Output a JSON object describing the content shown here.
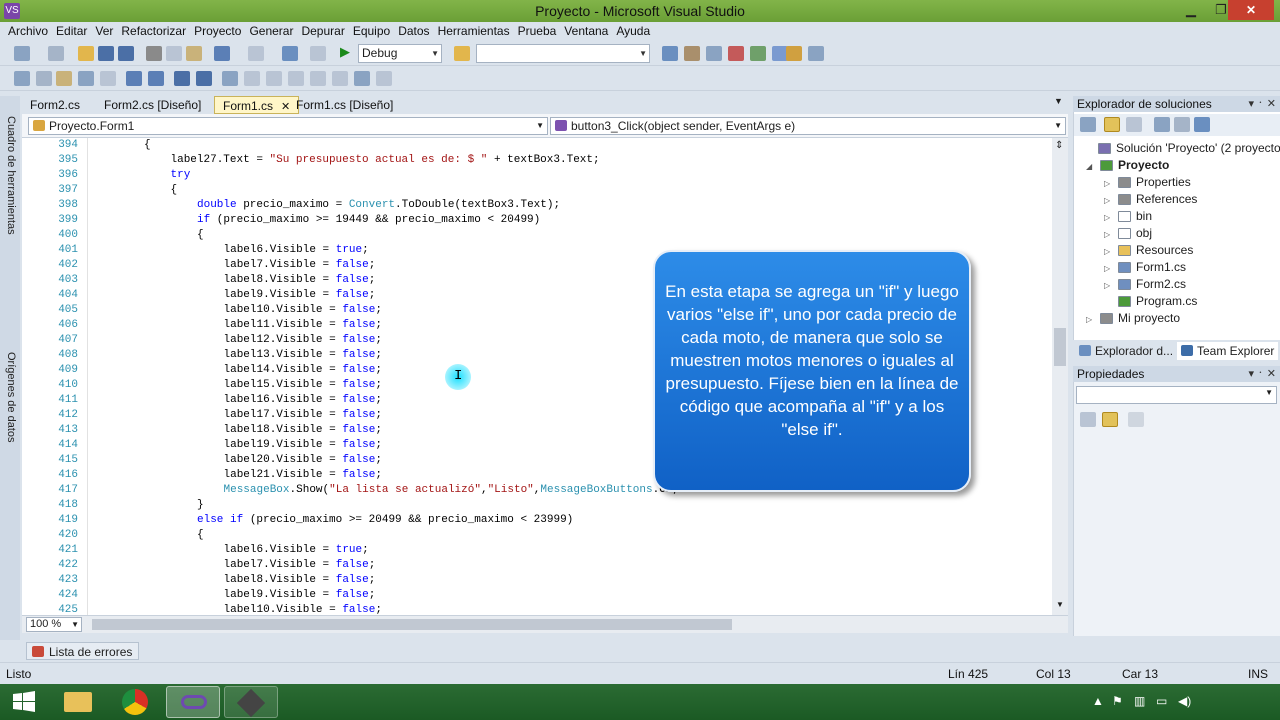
{
  "window": {
    "title": "Proyecto - Microsoft Visual Studio",
    "minimize": "▁",
    "restore": "❐",
    "close": "✕",
    "app_icon": "VS"
  },
  "menu": [
    "Archivo",
    "Editar",
    "Ver",
    "Refactorizar",
    "Proyecto",
    "Generar",
    "Depurar",
    "Equipo",
    "Datos",
    "Herramientas",
    "Prueba",
    "Ventana",
    "Ayuda"
  ],
  "toolbar": {
    "config": "Debug",
    "platform": ""
  },
  "left_tabs": {
    "toolbox": "Cuadro de herramientas",
    "datasources": "Orígenes de datos"
  },
  "editor_tabs": [
    {
      "label": "Form2.cs",
      "active": false
    },
    {
      "label": "Form2.cs [Diseño]",
      "active": false
    },
    {
      "label": "Form1.cs",
      "active": true
    },
    {
      "label": "Form1.cs [Diseño]",
      "active": false
    }
  ],
  "nav": {
    "class_combo": "Proyecto.Form1",
    "member_combo": "button3_Click(object sender, EventArgs e)"
  },
  "code": {
    "lines": [
      {
        "n": "394",
        "indent": 3,
        "parts": [
          [
            "",
            "{"
          ]
        ]
      },
      {
        "n": "395",
        "indent": 4,
        "parts": [
          [
            "",
            "label27.Text = "
          ],
          [
            "st",
            "\"Su presupuesto actual es de: $ \""
          ],
          [
            "",
            " + textBox3.Text;"
          ]
        ]
      },
      {
        "n": "396",
        "indent": 4,
        "parts": [
          [
            "kw",
            "try"
          ]
        ]
      },
      {
        "n": "397",
        "indent": 4,
        "parts": [
          [
            "",
            "{"
          ]
        ]
      },
      {
        "n": "398",
        "indent": 5,
        "parts": [
          [
            "kw",
            "double"
          ],
          [
            "",
            " precio_maximo = "
          ],
          [
            "ty",
            "Convert"
          ],
          [
            "",
            ".ToDouble(textBox3.Text);"
          ]
        ]
      },
      {
        "n": "399",
        "indent": 5,
        "parts": [
          [
            "kw",
            "if"
          ],
          [
            "",
            " (precio_maximo >= 19449 && precio_maximo < 20499)"
          ]
        ]
      },
      {
        "n": "400",
        "indent": 5,
        "parts": [
          [
            "",
            "{"
          ]
        ]
      },
      {
        "n": "401",
        "indent": 6,
        "parts": [
          [
            "",
            "label6.Visible = "
          ],
          [
            "kw",
            "true"
          ],
          [
            "",
            ";"
          ]
        ]
      },
      {
        "n": "402",
        "indent": 6,
        "parts": [
          [
            "",
            "label7.Visible = "
          ],
          [
            "kw",
            "false"
          ],
          [
            "",
            ";"
          ]
        ]
      },
      {
        "n": "403",
        "indent": 6,
        "parts": [
          [
            "",
            "label8.Visible = "
          ],
          [
            "kw",
            "false"
          ],
          [
            "",
            ";"
          ]
        ]
      },
      {
        "n": "404",
        "indent": 6,
        "parts": [
          [
            "",
            "label9.Visible = "
          ],
          [
            "kw",
            "false"
          ],
          [
            "",
            ";"
          ]
        ]
      },
      {
        "n": "405",
        "indent": 6,
        "parts": [
          [
            "",
            "label10.Visible = "
          ],
          [
            "kw",
            "false"
          ],
          [
            "",
            ";"
          ]
        ]
      },
      {
        "n": "406",
        "indent": 6,
        "parts": [
          [
            "",
            "label11.Visible = "
          ],
          [
            "kw",
            "false"
          ],
          [
            "",
            ";"
          ]
        ]
      },
      {
        "n": "407",
        "indent": 6,
        "parts": [
          [
            "",
            "label12.Visible = "
          ],
          [
            "kw",
            "false"
          ],
          [
            "",
            ";"
          ]
        ]
      },
      {
        "n": "408",
        "indent": 6,
        "parts": [
          [
            "",
            "label13.Visible = "
          ],
          [
            "kw",
            "false"
          ],
          [
            "",
            ";"
          ]
        ]
      },
      {
        "n": "409",
        "indent": 6,
        "parts": [
          [
            "",
            "label14.Visible = "
          ],
          [
            "kw",
            "false"
          ],
          [
            "",
            ";"
          ]
        ]
      },
      {
        "n": "410",
        "indent": 6,
        "parts": [
          [
            "",
            "label15.Visible = "
          ],
          [
            "kw",
            "false"
          ],
          [
            "",
            ";"
          ]
        ]
      },
      {
        "n": "411",
        "indent": 6,
        "parts": [
          [
            "",
            "label16.Visible = "
          ],
          [
            "kw",
            "false"
          ],
          [
            "",
            ";"
          ]
        ]
      },
      {
        "n": "412",
        "indent": 6,
        "parts": [
          [
            "",
            "label17.Visible = "
          ],
          [
            "kw",
            "false"
          ],
          [
            "",
            ";"
          ]
        ]
      },
      {
        "n": "413",
        "indent": 6,
        "parts": [
          [
            "",
            "label18.Visible = "
          ],
          [
            "kw",
            "false"
          ],
          [
            "",
            ";"
          ]
        ]
      },
      {
        "n": "414",
        "indent": 6,
        "parts": [
          [
            "",
            "label19.Visible = "
          ],
          [
            "kw",
            "false"
          ],
          [
            "",
            ";"
          ]
        ]
      },
      {
        "n": "415",
        "indent": 6,
        "parts": [
          [
            "",
            "label20.Visible = "
          ],
          [
            "kw",
            "false"
          ],
          [
            "",
            ";"
          ]
        ]
      },
      {
        "n": "416",
        "indent": 6,
        "parts": [
          [
            "",
            "label21.Visible = "
          ],
          [
            "kw",
            "false"
          ],
          [
            "",
            ";"
          ]
        ]
      },
      {
        "n": "417",
        "indent": 6,
        "parts": [
          [
            "ty",
            "MessageBox"
          ],
          [
            "",
            ".Show("
          ],
          [
            "st",
            "\"La lista se actualizó\""
          ],
          [
            "",
            ","
          ],
          [
            "st",
            "\"Listo\""
          ],
          [
            "",
            ","
          ],
          [
            "ty",
            "MessageBoxButtons"
          ],
          [
            "",
            ".OK,"
          ]
        ]
      },
      {
        "n": "418",
        "indent": 5,
        "parts": [
          [
            "",
            "}"
          ]
        ]
      },
      {
        "n": "419",
        "indent": 5,
        "parts": [
          [
            "kw",
            "else if"
          ],
          [
            "",
            " (precio_maximo >= 20499 && precio_maximo < 23999)"
          ]
        ]
      },
      {
        "n": "420",
        "indent": 5,
        "parts": [
          [
            "",
            "{"
          ]
        ]
      },
      {
        "n": "421",
        "indent": 6,
        "parts": [
          [
            "",
            "label6.Visible = "
          ],
          [
            "kw",
            "true"
          ],
          [
            "",
            ";"
          ]
        ]
      },
      {
        "n": "422",
        "indent": 6,
        "parts": [
          [
            "",
            "label7.Visible = "
          ],
          [
            "kw",
            "false"
          ],
          [
            "",
            ";"
          ]
        ]
      },
      {
        "n": "423",
        "indent": 6,
        "parts": [
          [
            "",
            "label8.Visible = "
          ],
          [
            "kw",
            "false"
          ],
          [
            "",
            ";"
          ]
        ]
      },
      {
        "n": "424",
        "indent": 6,
        "parts": [
          [
            "",
            "label9.Visible = "
          ],
          [
            "kw",
            "false"
          ],
          [
            "",
            ";"
          ]
        ]
      },
      {
        "n": "425",
        "indent": 6,
        "parts": [
          [
            "",
            "label10.Visible = "
          ],
          [
            "kw",
            "false"
          ],
          [
            "",
            ";"
          ]
        ]
      }
    ]
  },
  "zoom": "100 %",
  "callout": "En esta etapa se agrega un \"if\" y luego varios \"else if\", uno por cada precio de cada moto, de manera que solo se muestren motos menores o iguales al presupuesto. Fíjese bien en la línea de código que acompaña al \"if\" y a los \"else if\".",
  "error_list": "Lista de errores",
  "status": {
    "left": "Listo",
    "line": "Lín 425",
    "col": "Col 13",
    "car": "Car 13",
    "mode": "INS"
  },
  "solution_explorer": {
    "title": "Explorador de soluciones",
    "pins": "▾ ᛫ ✕",
    "items": [
      {
        "label": "Solución 'Proyecto' (2 proyectos)",
        "level": 0,
        "expander": "",
        "icon": "#7a6fb0",
        "bold": false
      },
      {
        "label": "Proyecto",
        "level": 1,
        "expander": "◢",
        "icon": "#4c9a3a",
        "bold": true
      },
      {
        "label": "Properties",
        "level": 2,
        "expander": "▷",
        "icon": "#8c8c8c",
        "bold": false
      },
      {
        "label": "References",
        "level": 2,
        "expander": "▷",
        "icon": "#8c8c8c",
        "bold": false
      },
      {
        "label": "bin",
        "level": 2,
        "expander": "▷",
        "icon": "#ffffff",
        "bold": false
      },
      {
        "label": "obj",
        "level": 2,
        "expander": "▷",
        "icon": "#ffffff",
        "bold": false
      },
      {
        "label": "Resources",
        "level": 2,
        "expander": "▷",
        "icon": "#e8c15a",
        "bold": false
      },
      {
        "label": "Form1.cs",
        "level": 2,
        "expander": "▷",
        "icon": "#6f8fbf",
        "bold": false
      },
      {
        "label": "Form2.cs",
        "level": 2,
        "expander": "▷",
        "icon": "#6f8fbf",
        "bold": false
      },
      {
        "label": "Program.cs",
        "level": 2,
        "expander": "",
        "icon": "#4c9a3a",
        "bold": false
      },
      {
        "label": "Mi proyecto",
        "level": 1,
        "expander": "▷",
        "icon": "#8c8c8c",
        "bold": false
      }
    ],
    "tabs": [
      "Explorador d...",
      "Team Explorer"
    ]
  },
  "properties": {
    "title": "Propiedades",
    "pins": "▾ ᛫ ✕"
  },
  "taskbar": {
    "apps": [
      "start",
      "explorer",
      "chrome",
      "visual-studio",
      "app"
    ]
  }
}
